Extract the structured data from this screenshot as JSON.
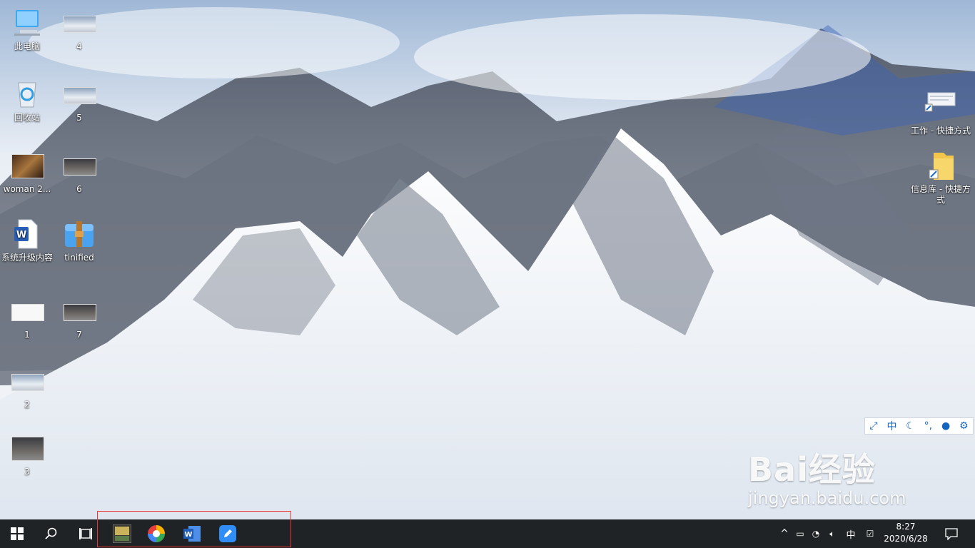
{
  "desktop_icons": {
    "pc": "此电脑",
    "img4": "4",
    "recycle": "回收站",
    "img5": "5",
    "woman": "woman 2...",
    "img6": "6",
    "doc": "系统升级内容",
    "tinified": "tinified",
    "img1": "1",
    "img7": "7",
    "img2": "2",
    "img3": "3",
    "shortcut_work": "工作 - 快捷方式",
    "shortcut_info": "信息库 - 快捷方式"
  },
  "ime_bar": {
    "lang": "中"
  },
  "watermark": {
    "logo": "Bai经验",
    "url": "jingyan.baidu.com"
  },
  "taskbar": {
    "apps": [
      "start-menu",
      "search",
      "task-view",
      "game-app",
      "browser-app",
      "word-app",
      "notes-app"
    ],
    "tray": {
      "chevron": "^",
      "ime": "中"
    },
    "clock": {
      "time": "8:27",
      "date": "2020/6/28"
    }
  },
  "colors": {
    "taskbar": "#1f2325",
    "accent": "#0078d7",
    "highlight": "#e33333"
  }
}
